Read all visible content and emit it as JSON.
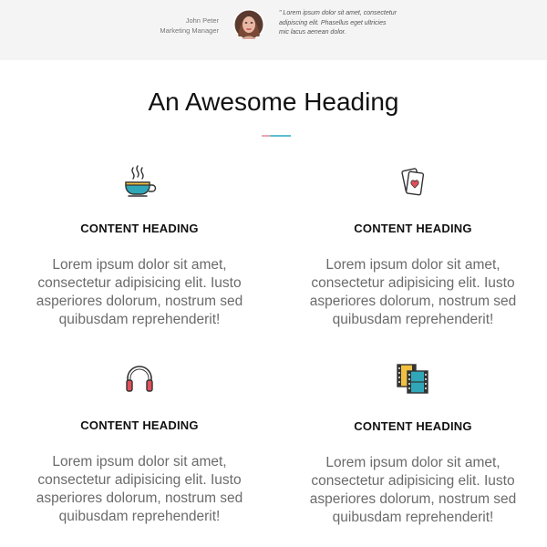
{
  "testimonial": {
    "author_name": "John Peter",
    "author_title": "Marketing Manager",
    "quote": "\" Lorem ipsum dolor sit amet, consectetur adipiscing elit. Phasellus eget ultricies mic lacus aenean dolor."
  },
  "main": {
    "heading": "An Awesome Heading"
  },
  "cards": [
    {
      "icon": "coffee-cup-icon",
      "heading": "CONTENT HEADING",
      "body": "Lorem ipsum dolor sit amet, consectetur adipisicing elit. Iusto asperiores dolorum, nostrum sed quibusdam reprehenderit!"
    },
    {
      "icon": "playing-cards-icon",
      "heading": "CONTENT HEADING",
      "body": "Lorem ipsum dolor sit amet, consectetur adipisicing elit. Iusto asperiores dolorum, nostrum sed quibusdam reprehenderit!"
    },
    {
      "icon": "headphones-icon",
      "heading": "CONTENT HEADING",
      "body": "Lorem ipsum dolor sit amet, consectetur adipisicing elit. Iusto asperiores dolorum, nostrum sed quibusdam reprehenderit!"
    },
    {
      "icon": "film-strip-icon",
      "heading": "CONTENT HEADING",
      "body": "Lorem ipsum dolor sit amet, consectetur adipisicing elit. Iusto asperiores dolorum, nostrum sed quibusdam reprehenderit!"
    }
  ],
  "colors": {
    "testimonial_bg": "#f4f4f4",
    "teal_accent": "#2fa7b8",
    "pink_accent": "#e39aa6",
    "body_text": "#6b6b6b"
  }
}
